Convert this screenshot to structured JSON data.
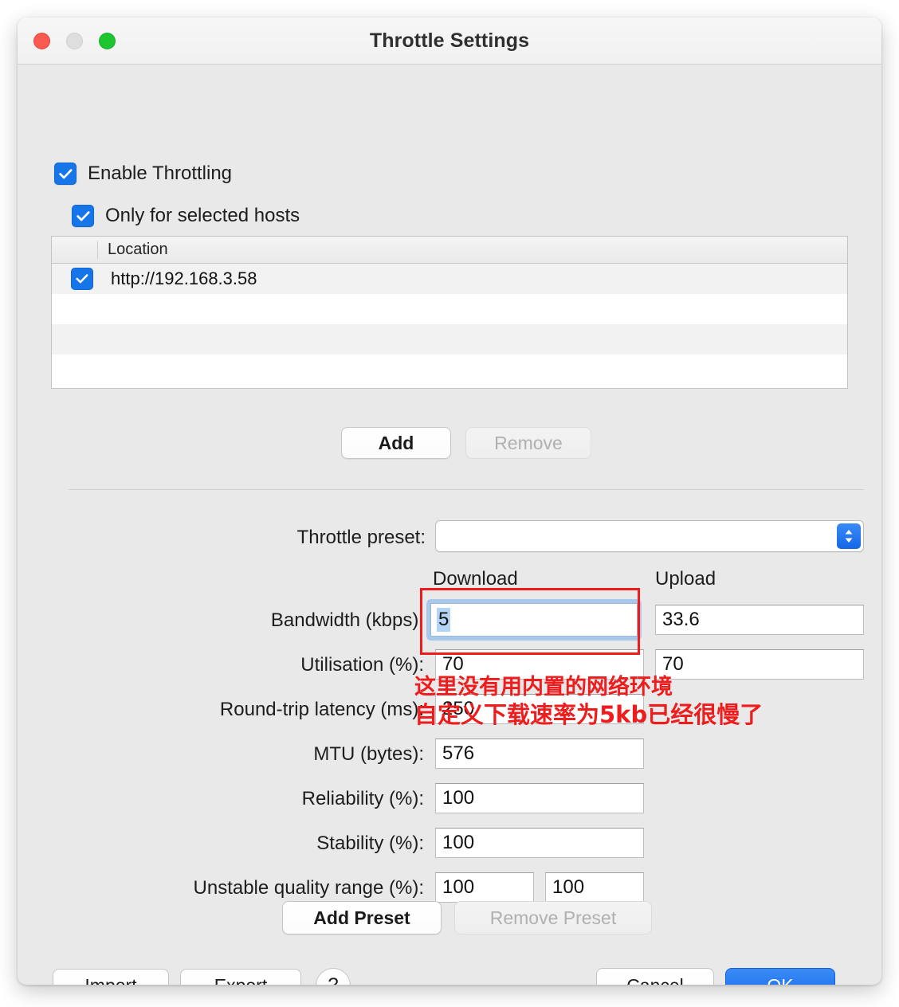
{
  "window": {
    "title": "Throttle Settings",
    "traffic_lights": [
      "close",
      "minimize",
      "maximize"
    ]
  },
  "options": {
    "enable_throttling_label": "Enable Throttling",
    "enable_throttling_checked": true,
    "only_selected_hosts_label": "Only for selected hosts",
    "only_selected_hosts_checked": true
  },
  "hosts_table": {
    "column_header": "Location",
    "rows": [
      {
        "checked": true,
        "location": "http://192.168.3.58"
      },
      {
        "checked": false,
        "location": ""
      },
      {
        "checked": false,
        "location": ""
      },
      {
        "checked": false,
        "location": ""
      }
    ],
    "add_label": "Add",
    "remove_label": "Remove",
    "remove_disabled": true
  },
  "preset": {
    "label": "Throttle preset:",
    "value": "",
    "options": []
  },
  "columns": {
    "download": "Download",
    "upload": "Upload"
  },
  "fields": {
    "bandwidth": {
      "label": "Bandwidth (kbps):",
      "download": "5",
      "upload": "33.6",
      "download_focused": true,
      "download_selected": true
    },
    "utilisation": {
      "label": "Utilisation (%):",
      "download": "70",
      "upload": "70"
    },
    "latency": {
      "label": "Round-trip latency (ms):",
      "download": "250"
    },
    "mtu": {
      "label": "MTU (bytes):",
      "value": "576"
    },
    "reliability": {
      "label": "Reliability (%):",
      "value": "100"
    },
    "stability": {
      "label": "Stability (%):",
      "value": "100"
    },
    "unstable_quality": {
      "label": "Unstable quality range (%):",
      "min": "100",
      "max": "100"
    }
  },
  "preset_buttons": {
    "add_label": "Add Preset",
    "remove_label": "Remove Preset",
    "remove_disabled": true
  },
  "footer": {
    "import_label": "Import",
    "export_label": "Export",
    "help_label": "?",
    "cancel_label": "Cancel",
    "ok_label": "OK"
  },
  "annotations": {
    "color": "#ee1c1c",
    "line1": "这里没有用内置的网络环境",
    "line2": "自定义下载速率为5kb已经很慢了",
    "highlight_target": "bandwidth-download-field"
  }
}
